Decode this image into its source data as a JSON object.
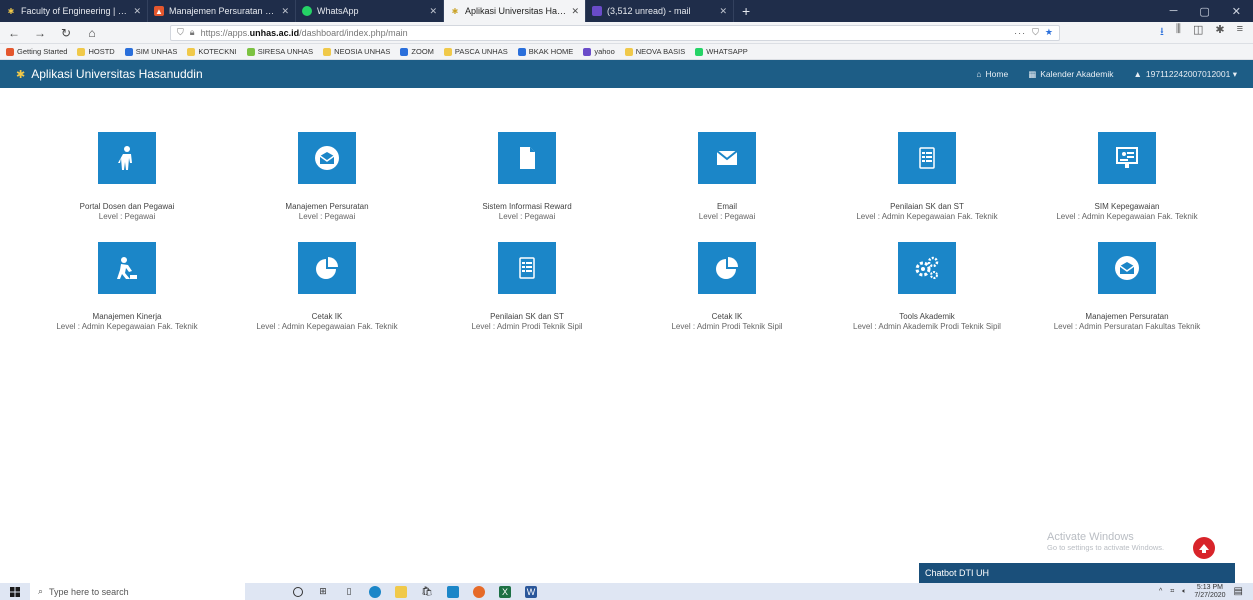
{
  "browser": {
    "tabs": [
      {
        "title": "Faculty of Engineering | Hasan",
        "icon": "unhas-icon",
        "color": "#f0c94a"
      },
      {
        "title": "Manajemen Persuratan - Inbox",
        "icon": "app-red-icon",
        "color": "#e4572e"
      },
      {
        "title": "WhatsApp",
        "icon": "whatsapp-icon",
        "color": "#25d366"
      },
      {
        "title": "Aplikasi Universitas Hasanuddin",
        "icon": "unhas-icon",
        "color": "#f0c94a"
      },
      {
        "title": "(3,512 unread) - mail",
        "icon": "mail-icon",
        "color": "#6a4cc9"
      }
    ],
    "url_prefix": "https://apps.",
    "url_domain": "unhas.ac.id",
    "url_path": "/dashboard/index.php/main",
    "url_tail": "···",
    "bookmarks": [
      {
        "label": "Getting Started",
        "color": "#e4572e"
      },
      {
        "label": "HOSTD",
        "color": "#f0c94a"
      },
      {
        "label": "SIM UNHAS",
        "color": "#2a6fdb"
      },
      {
        "label": "KOTECKNI",
        "color": "#f0c94a"
      },
      {
        "label": "SIRESA UNHAS",
        "color": "#7cc242"
      },
      {
        "label": "NEOSIA UNHAS",
        "color": "#f0c94a"
      },
      {
        "label": "ZOOM",
        "color": "#2a6fdb"
      },
      {
        "label": "PASCA UNHAS",
        "color": "#f0c94a"
      },
      {
        "label": "BKAK HOME",
        "color": "#2a6fdb"
      },
      {
        "label": "yahoo",
        "color": "#6a4cc9"
      },
      {
        "label": "NEOVA BASIS",
        "color": "#f0c94a"
      },
      {
        "label": "WHATSAPP",
        "color": "#25d366"
      }
    ]
  },
  "app": {
    "title": "Aplikasi Universitas Hasanuddin",
    "menu": {
      "home": "Home",
      "calendar": "Kalender Akademik",
      "user": "197112242007012001 ▾"
    }
  },
  "tiles": [
    {
      "name": "Portal Dosen dan Pegawai",
      "level": "Level : Pegawai",
      "icon": "person-walking-icon"
    },
    {
      "name": "Manajemen Persuratan",
      "level": "Level : Pegawai",
      "icon": "envelope-open-icon"
    },
    {
      "name": "Sistem Informasi Reward",
      "level": "Level : Pegawai",
      "icon": "document-icon"
    },
    {
      "name": "Email",
      "level": "Level : Pegawai",
      "icon": "envelope-icon"
    },
    {
      "name": "Penilaian SK dan ST",
      "level": "Level : Admin Kepegawaian Fak. Teknik",
      "icon": "form-icon"
    },
    {
      "name": "SIM Kepegawaian",
      "level": "Level : Admin Kepegawaian Fak. Teknik",
      "icon": "presentation-icon"
    },
    {
      "name": "Manajemen Kinerja",
      "level": "Level : Admin Kepegawaian Fak. Teknik",
      "icon": "worker-icon"
    },
    {
      "name": "Cetak IK",
      "level": "Level : Admin Kepegawaian Fak. Teknik",
      "icon": "pie-chart-icon"
    },
    {
      "name": "Penilaian SK dan ST",
      "level": "Level : Admin Prodi Teknik Sipil",
      "icon": "form-icon"
    },
    {
      "name": "Cetak IK",
      "level": "Level : Admin Prodi Teknik Sipil",
      "icon": "pie-chart-icon"
    },
    {
      "name": "Tools Akademik",
      "level": "Level : Admin Akademik Prodi Teknik Sipil",
      "icon": "gears-icon"
    },
    {
      "name": "Manajemen Persuratan",
      "level": "Level : Admin Persuratan Fakultas Teknik",
      "icon": "envelope-open-icon"
    }
  ],
  "watermark": {
    "line1": "Activate Windows",
    "line2": "Go to settings to activate Windows."
  },
  "chatbot": "Chatbot DTI UH",
  "taskbar": {
    "search_placeholder": "Type here to search",
    "time": "5:13 PM",
    "date": "7/27/2020"
  },
  "colors": {
    "header": "#1d5d86",
    "tile": "#1b86c8",
    "chatbot": "#1a4f7a"
  }
}
